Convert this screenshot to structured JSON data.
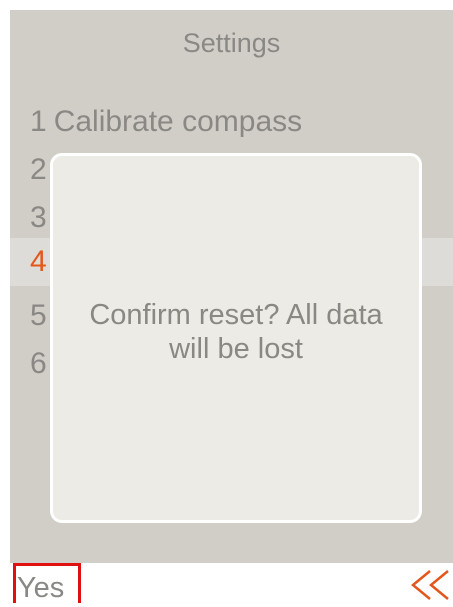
{
  "screen": {
    "title": "Settings",
    "menu": [
      {
        "number": "1",
        "label": "Calibrate compass"
      },
      {
        "number": "2",
        "label": ""
      },
      {
        "number": "3",
        "label": ""
      },
      {
        "number": "4",
        "label": ""
      },
      {
        "number": "5",
        "label": ""
      },
      {
        "number": "6",
        "label": ""
      }
    ],
    "selected_index": 4
  },
  "dialog": {
    "message": "Confirm reset? All data will be lost"
  },
  "softkeys": {
    "left_label": "Yes",
    "right_icon": "double-chevron-left-icon"
  },
  "colors": {
    "screen_background": "#d1cec7",
    "dialog_background": "#ecebe5",
    "selected_row": "#dedcd8",
    "accent": "#e3571c",
    "text": "#8a8884",
    "focus_outline": "#e01010"
  }
}
